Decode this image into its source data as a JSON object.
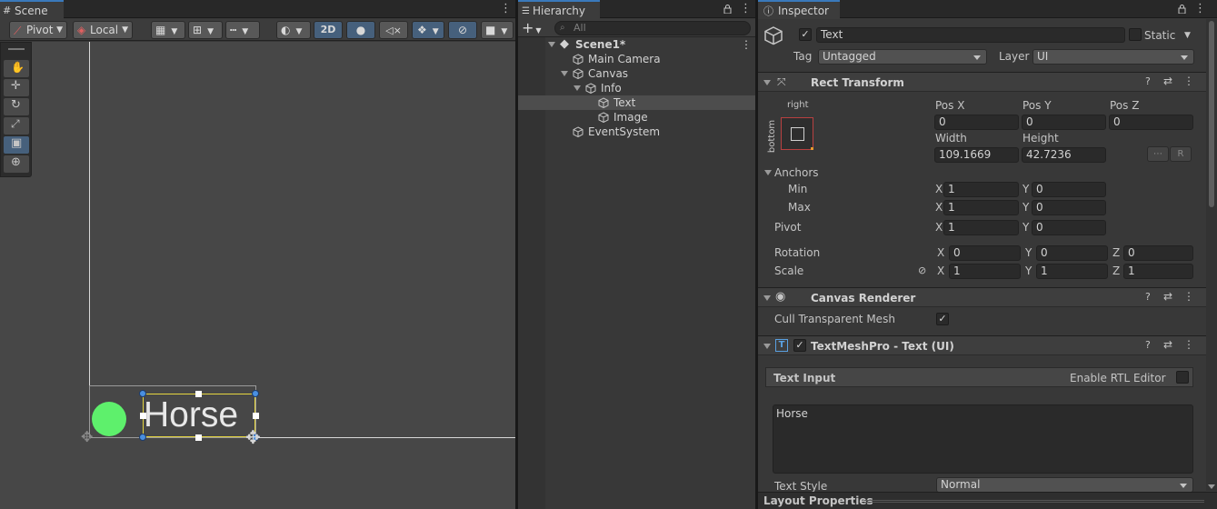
{
  "scene": {
    "tab_label": "Scene",
    "toolbar": {
      "pivot_label": "Pivot",
      "local_label": "Local",
      "mode_2d_label": "2D"
    },
    "text_object": "Horse"
  },
  "hierarchy": {
    "tab_label": "Hierarchy",
    "search_placeholder": "All",
    "items": [
      {
        "label": "Scene1*"
      },
      {
        "label": "Main Camera"
      },
      {
        "label": "Canvas"
      },
      {
        "label": "Info"
      },
      {
        "label": "Text"
      },
      {
        "label": "Image"
      },
      {
        "label": "EventSystem"
      }
    ]
  },
  "inspector": {
    "tab_label": "Inspector",
    "object_name": "Text",
    "static_label": "Static",
    "tag_label": "Tag",
    "tag_value": "Untagged",
    "layer_label": "Layer",
    "layer_value": "UI",
    "rect_transform": {
      "title": "Rect Transform",
      "anchor_h": "right",
      "anchor_v": "bottom",
      "pos_x_label": "Pos X",
      "pos_x": "0",
      "pos_y_label": "Pos Y",
      "pos_y": "0",
      "pos_z_label": "Pos Z",
      "pos_z": "0",
      "width_label": "Width",
      "width": "109.1669",
      "height_label": "Height",
      "height": "42.7236",
      "r_button": "R",
      "anchors_label": "Anchors",
      "min_label": "Min",
      "min_x": "1",
      "min_y": "0",
      "max_label": "Max",
      "max_x": "1",
      "max_y": "0",
      "pivot_label": "Pivot",
      "pivot_x": "1",
      "pivot_y": "0",
      "rotation_label": "Rotation",
      "rot_x": "0",
      "rot_y": "0",
      "rot_z": "0",
      "scale_label": "Scale",
      "scale_x": "1",
      "scale_y": "1",
      "scale_z": "1",
      "x": "X",
      "y": "Y",
      "z": "Z"
    },
    "canvas_renderer": {
      "title": "Canvas Renderer",
      "cull_label": "Cull Transparent Mesh"
    },
    "tmp": {
      "title": "TextMeshPro - Text (UI)",
      "text_input_label": "Text Input",
      "rtl_label": "Enable RTL Editor",
      "text_value": "Horse",
      "text_style_label": "Text Style",
      "text_style_value": "Normal"
    },
    "layout_properties": "Layout Properties"
  },
  "colors": {
    "accent": "#3a79bb",
    "selection": "#46607c",
    "green_circle": "#5ef06c"
  }
}
